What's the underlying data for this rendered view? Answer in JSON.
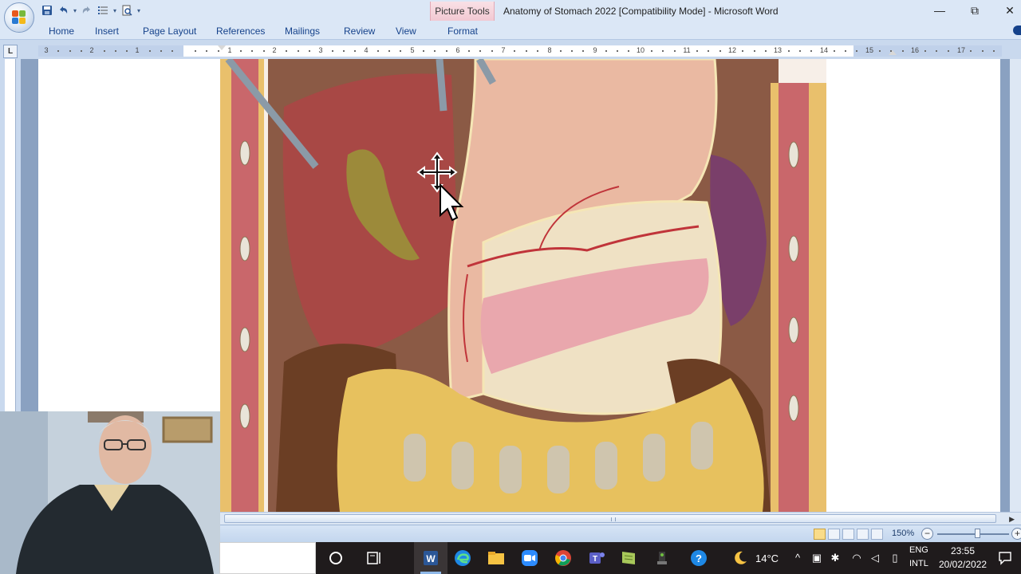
{
  "window": {
    "title": "Anatomy of  Stomach 2022 [Compatibility Mode] - Microsoft Word",
    "context_tab": "Picture Tools",
    "minimize": "—",
    "restore": "⧉",
    "close": "✕"
  },
  "quick_access": {
    "save_icon": "save-icon",
    "undo_icon": "undo-icon",
    "redo_icon": "redo-icon",
    "list_icon": "list-icon",
    "preview_icon": "print-preview-icon",
    "customize": "▾"
  },
  "ribbon": {
    "tabs": [
      "Home",
      "Insert",
      "Page Layout",
      "References",
      "Mailings",
      "Review",
      "View",
      "Format"
    ]
  },
  "ruler": {
    "labels": [
      "3",
      "2",
      "1",
      "1",
      "2",
      "3",
      "4",
      "5",
      "6",
      "7",
      "8",
      "9",
      "10",
      "11",
      "12",
      "13",
      "14",
      "15",
      "16",
      "17"
    ],
    "tab_selector": "L"
  },
  "statusbar": {
    "zoom_level": "150%",
    "zoom_minus": "−",
    "zoom_plus": "+",
    "zoom_fraction": 0.55
  },
  "taskbar": {
    "weather": "14°C",
    "language_line1": "ENG",
    "language_line2": "INTL",
    "time": "23:55",
    "date": "20/02/2022",
    "apps": [
      "cortana-icon",
      "task-view-icon",
      "word-icon",
      "edge-icon",
      "file-explorer-icon",
      "zoom-icon",
      "chrome-icon",
      "teams-icon",
      "notepad-icon",
      "app-icon",
      "help-icon"
    ]
  },
  "colors": {
    "titlebar": "#dbe7f6",
    "ribbon_text": "#15428b",
    "context_tab": "#f2c8d2",
    "taskbar": "#1f1b1c",
    "doc_background": "#8aa1c1"
  }
}
